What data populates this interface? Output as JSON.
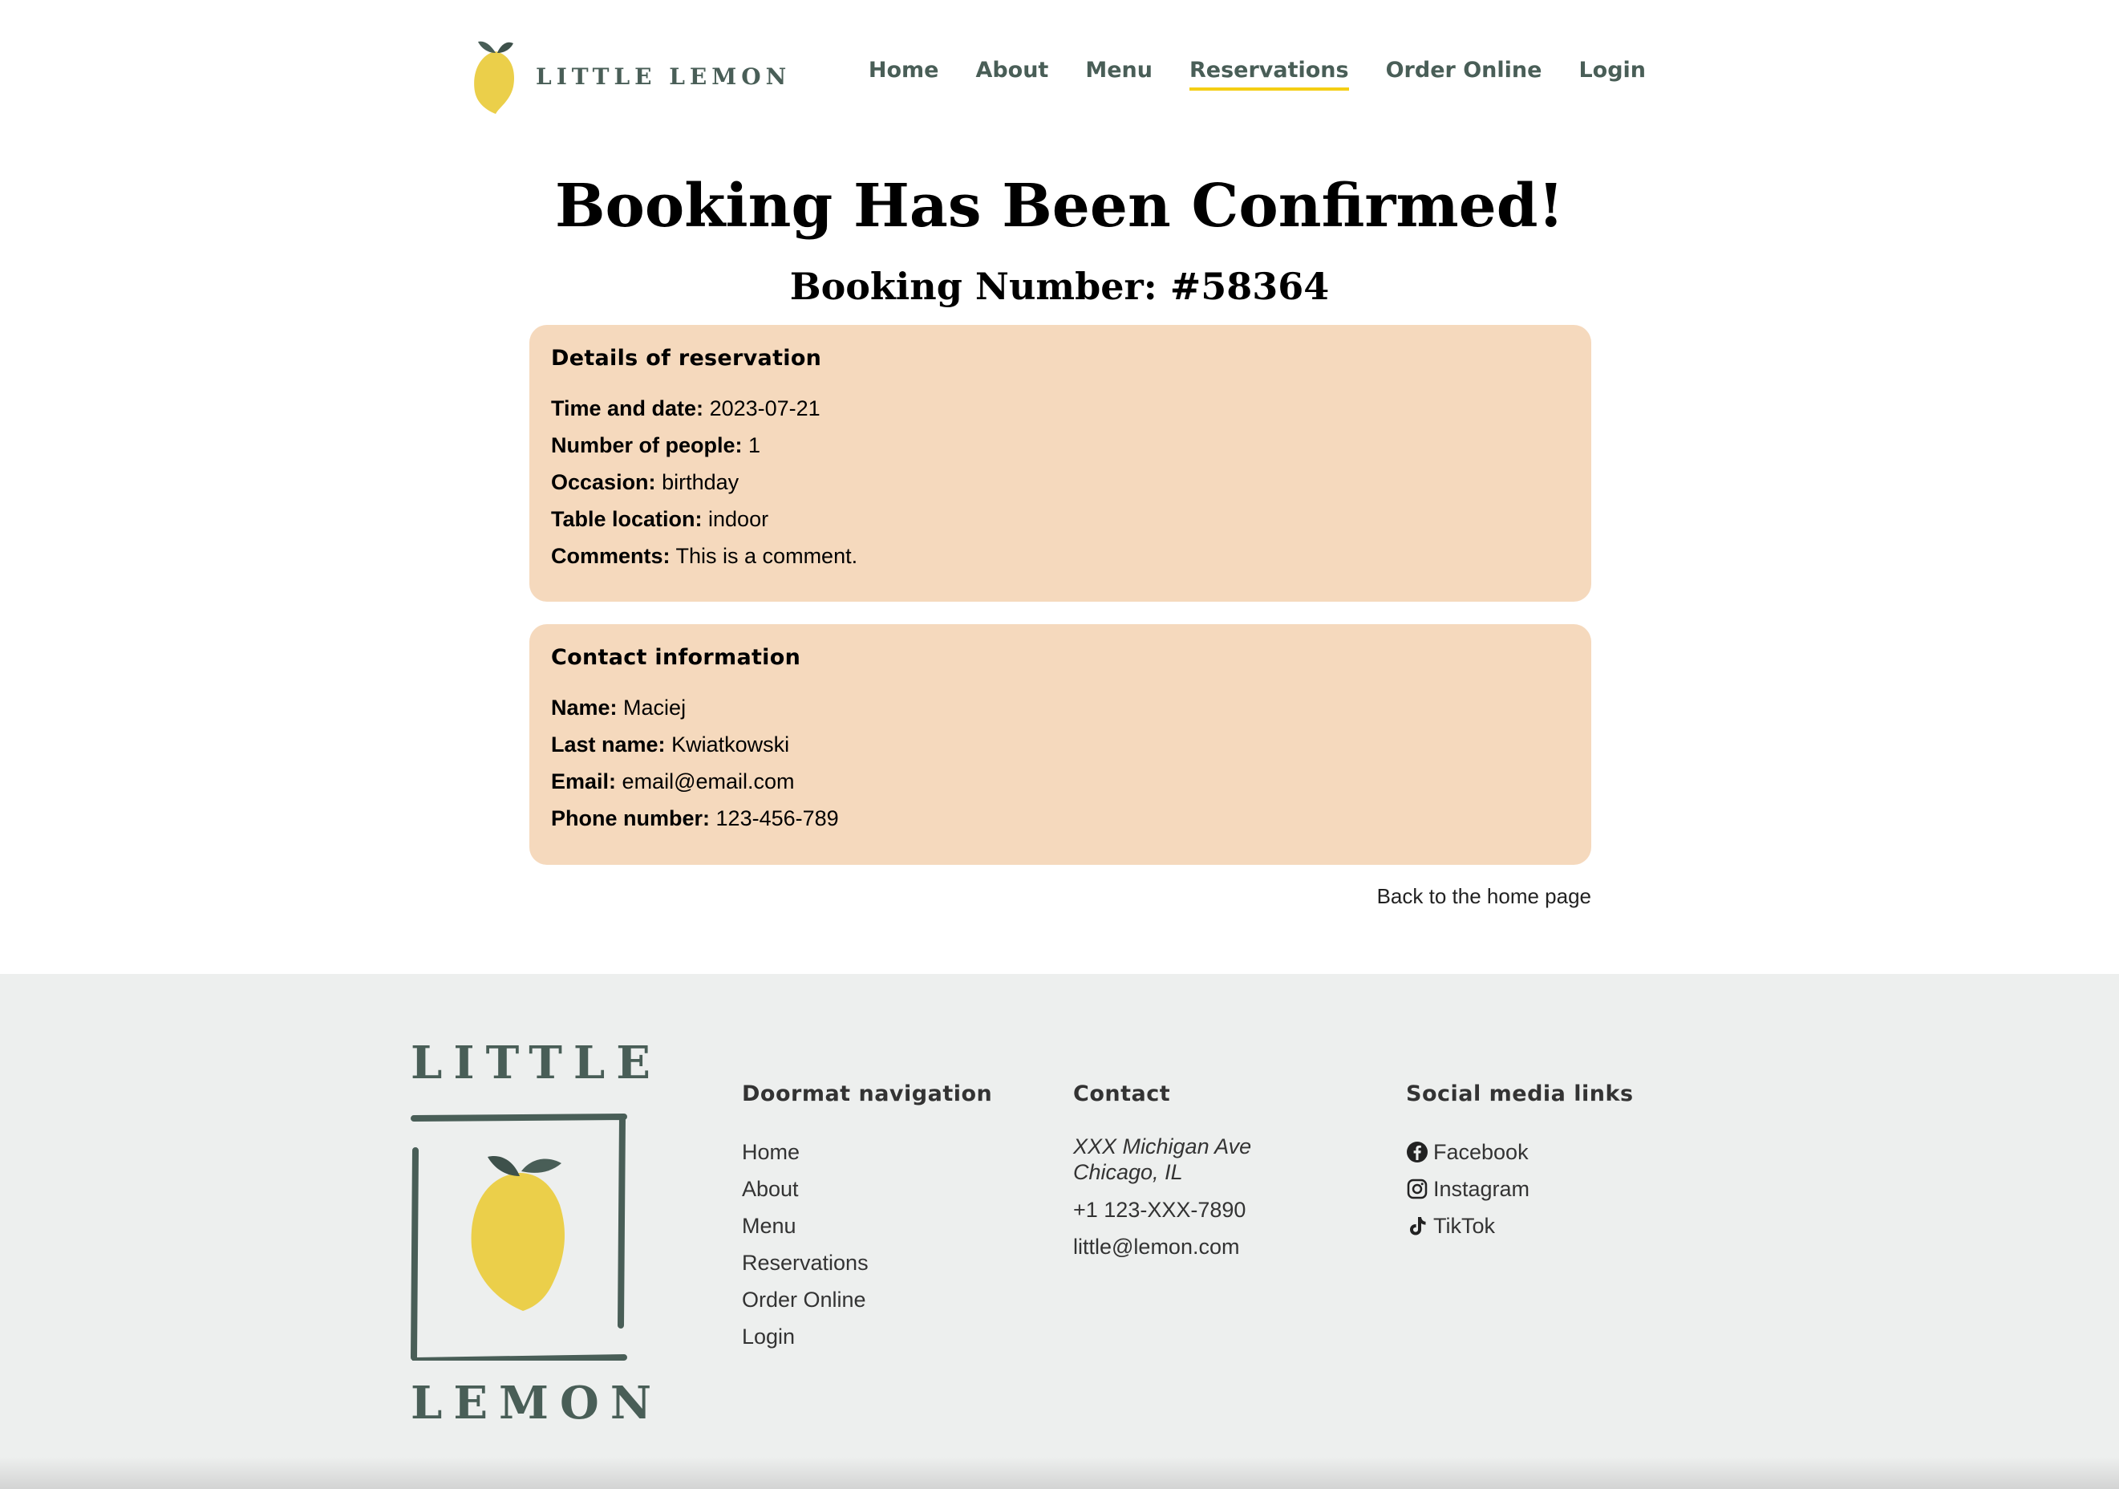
{
  "header": {
    "logo_text": "LITTLE LEMON",
    "nav": [
      {
        "label": "Home"
      },
      {
        "label": "About"
      },
      {
        "label": "Menu"
      },
      {
        "label": "Reservations",
        "active": true
      },
      {
        "label": "Order Online"
      },
      {
        "label": "Login"
      }
    ]
  },
  "main": {
    "headline": "Booking Has Been Confirmed!",
    "booking_number": "Booking Number: #58364",
    "details": {
      "title": "Details of reservation",
      "rows": [
        {
          "label": "Time and date:",
          "value": "2023-07-21"
        },
        {
          "label": "Number of people:",
          "value": "1"
        },
        {
          "label": "Occasion:",
          "value": "birthday"
        },
        {
          "label": "Table location:",
          "value": "indoor"
        },
        {
          "label": "Comments:",
          "value": "This is a comment."
        }
      ]
    },
    "contact": {
      "title": "Contact information",
      "rows": [
        {
          "label": "Name:",
          "value": "Maciej"
        },
        {
          "label": "Last name:",
          "value": "Kwiatkowski"
        },
        {
          "label": "Email:",
          "value": "email@email.com"
        },
        {
          "label": "Phone number:",
          "value": "123-456-789"
        }
      ]
    },
    "back_link": "Back to the home page"
  },
  "footer": {
    "logo_top": "LITTLE",
    "logo_bottom": "LEMON",
    "nav_title": "Doormat navigation",
    "nav_items": [
      "Home",
      "About",
      "Menu",
      "Reservations",
      "Order Online",
      "Login"
    ],
    "contact_title": "Contact",
    "address_line1": "XXX Michigan Ave",
    "address_line2": "Chicago, IL",
    "phone": "+1 123-XXX-7890",
    "email": "little@lemon.com",
    "social_title": "Social media links",
    "social": [
      {
        "label": "Facebook",
        "icon": "facebook-icon"
      },
      {
        "label": "Instagram",
        "icon": "instagram-icon"
      },
      {
        "label": "TikTok",
        "icon": "tiktok-icon"
      }
    ]
  },
  "colors": {
    "brand_green": "#495E57",
    "brand_yellow": "#F4CE14",
    "card_bg": "#F5D9BD",
    "footer_bg": "#EDEFEE"
  }
}
